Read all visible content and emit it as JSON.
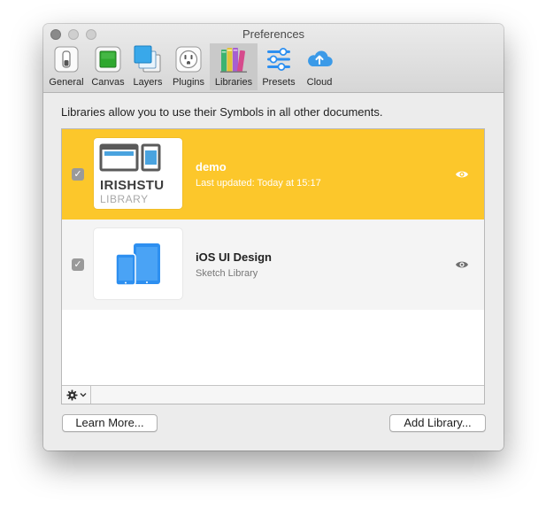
{
  "window": {
    "title": "Preferences"
  },
  "toolbar": {
    "items": [
      {
        "label": "General",
        "icon": "general-switch-icon"
      },
      {
        "label": "Canvas",
        "icon": "canvas-icon"
      },
      {
        "label": "Layers",
        "icon": "layers-icon"
      },
      {
        "label": "Plugins",
        "icon": "plugins-outlet-icon"
      },
      {
        "label": "Libraries",
        "icon": "libraries-books-icon",
        "selected": true
      },
      {
        "label": "Presets",
        "icon": "presets-sliders-icon"
      },
      {
        "label": "Cloud",
        "icon": "cloud-upload-icon"
      }
    ]
  },
  "libraries": {
    "intro": "Libraries allow you to use their Symbols in all other documents.",
    "items": [
      {
        "name": "demo",
        "subtitle": "Last updated: Today at 15:17",
        "enabled": true,
        "selected": true,
        "thumb_title": "IRISHSTU",
        "thumb_subtitle": "LIBRARY"
      },
      {
        "name": "iOS UI Design",
        "subtitle": "Sketch Library",
        "enabled": true,
        "selected": false
      }
    ],
    "checkmark": "✓"
  },
  "footer": {
    "learn_more": "Learn More...",
    "add_library": "Add Library..."
  },
  "colors": {
    "selected_row": "#fcc72b",
    "accent_blue": "#2d8ff0"
  }
}
